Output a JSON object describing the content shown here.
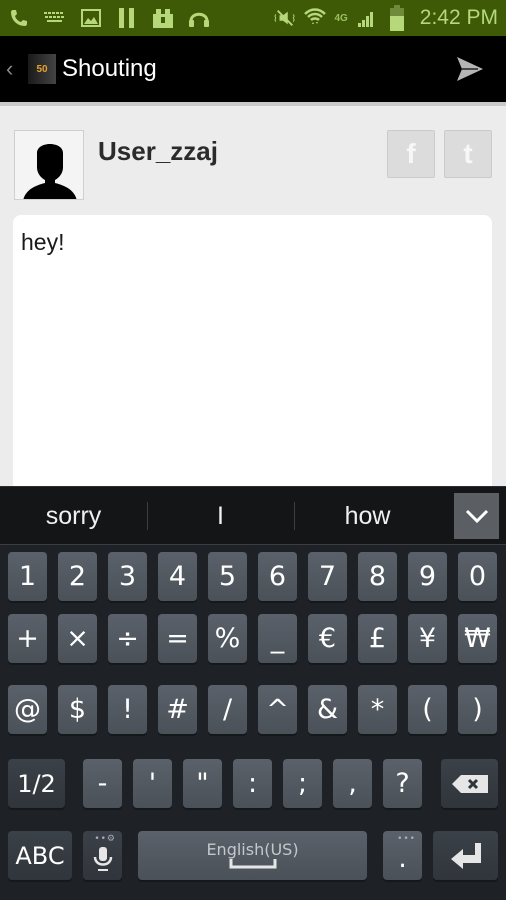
{
  "status_bar": {
    "left_icons": [
      "phone-icon",
      "keyboard-icon",
      "image-icon",
      "pause-icon",
      "store-icon",
      "headphones-icon"
    ],
    "right_icons": [
      "mute-vibrate-icon",
      "wifi-icon",
      "signal-icon",
      "battery-icon"
    ],
    "network": "4G",
    "time": "2:42 PM",
    "background_color": "#3e5a06",
    "icon_color": "#b6d77a"
  },
  "action_bar": {
    "back_glyph": "‹",
    "logo_text": "50",
    "title": "Shouting",
    "send_icon": "send-icon"
  },
  "post": {
    "username": "User_zzaj",
    "message": "hey!",
    "share_buttons": [
      {
        "name": "facebook",
        "glyph": "f"
      },
      {
        "name": "twitter",
        "glyph": "t"
      }
    ]
  },
  "keyboard": {
    "suggestions": [
      "sorry",
      "I",
      "how"
    ],
    "row1": [
      "1",
      "2",
      "3",
      "4",
      "5",
      "6",
      "7",
      "8",
      "9",
      "0"
    ],
    "row2": [
      "+",
      "×",
      "÷",
      "=",
      "%",
      "_",
      "€",
      "£",
      "¥",
      "₩"
    ],
    "row3": [
      "@",
      "$",
      "!",
      "#",
      "/",
      "^",
      "&",
      "*",
      "(",
      ")"
    ],
    "row4": {
      "page_key": "1/2",
      "keys": [
        "-",
        "'",
        "\"",
        ":",
        ";",
        ",",
        "?"
      ],
      "backspace": "backspace-icon"
    },
    "row5": {
      "abc_key": "ABC",
      "mic_key": "microphone-icon",
      "space_label": "English(US)",
      "period_key": ".",
      "period_sub": "•••",
      "mic_sub": "••⚙",
      "enter_key": "enter-icon"
    }
  }
}
